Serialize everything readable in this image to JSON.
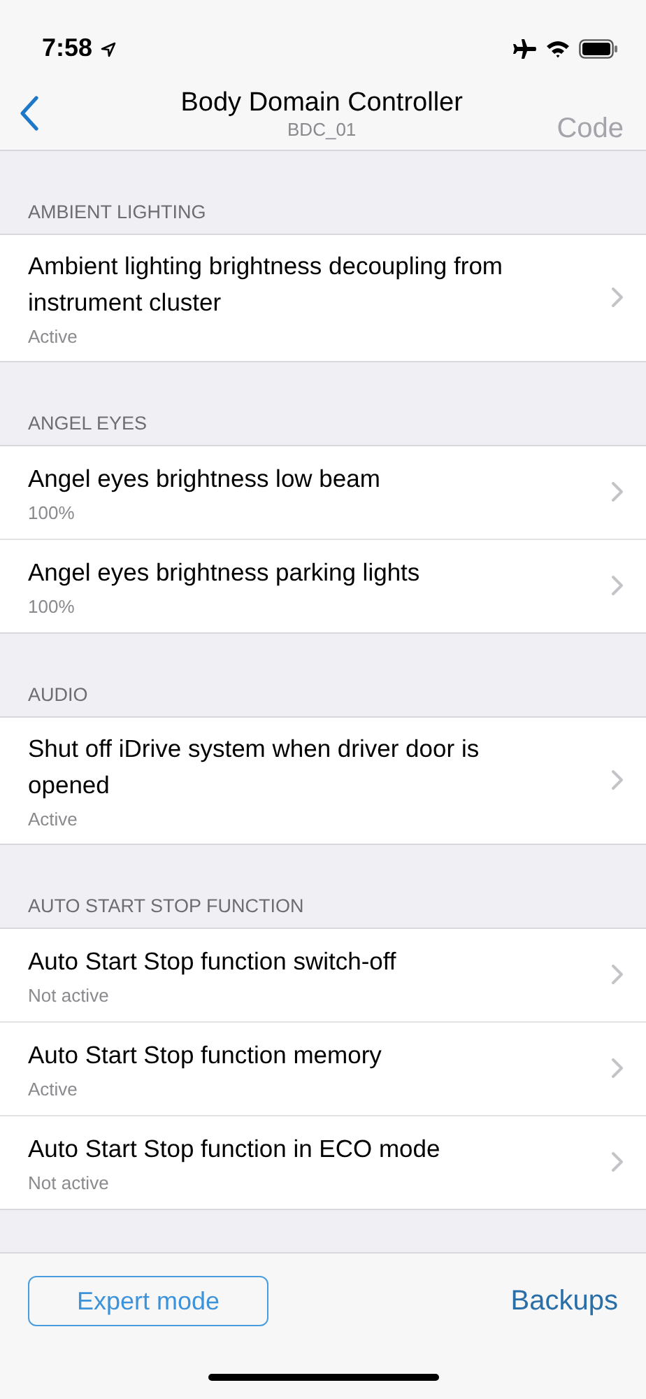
{
  "status_bar": {
    "time": "7:58"
  },
  "nav": {
    "title": "Body Domain Controller",
    "subtitle": "BDC_01",
    "action": {
      "label": "Code",
      "disabled": true
    }
  },
  "sections": [
    {
      "header": "AMBIENT LIGHTING",
      "items": [
        {
          "title": "Ambient lighting brightness decoupling from instrument cluster",
          "value": "Active"
        }
      ]
    },
    {
      "header": "ANGEL EYES",
      "items": [
        {
          "title": "Angel eyes brightness low beam",
          "value": "100%"
        },
        {
          "title": "Angel eyes brightness parking lights",
          "value": "100%"
        }
      ]
    },
    {
      "header": "AUDIO",
      "items": [
        {
          "title": "Shut off iDrive system when driver door is opened",
          "value": "Active"
        }
      ]
    },
    {
      "header": "AUTO START STOP FUNCTION",
      "items": [
        {
          "title": "Auto Start Stop function switch-off",
          "value": "Not active"
        },
        {
          "title": "Auto Start Stop function memory",
          "value": "Active"
        },
        {
          "title": "Auto Start Stop function in ECO mode",
          "value": "Not active"
        }
      ]
    }
  ],
  "footer": {
    "primary": "Expert mode",
    "secondary": "Backups"
  }
}
